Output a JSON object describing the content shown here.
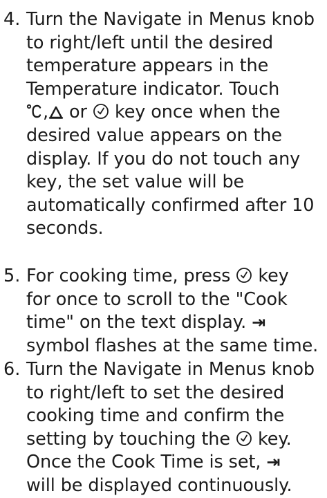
{
  "steps": [
    {
      "number": "4.",
      "lines": [
        "Turn the Navigate in Menus knob",
        "to right/left until the desired",
        "temperature appears in the",
        "Temperature indicator. Touch",
        ",",
        "or",
        "key once when the",
        "desired value appears on the",
        "display. If you do not touch any",
        "key, the set value will be",
        "automatically confirmed after 10",
        "seconds."
      ]
    },
    {
      "number": "5.",
      "lines": [
        "For cooking time, press",
        "key",
        "for once to scroll to the \"Cook",
        "time\" on the text display.",
        "symbol flashes at the same time."
      ]
    },
    {
      "number": "6.",
      "lines": [
        "Turn the Navigate in Menus knob",
        "to right/left to set the desired",
        "cooking time and confirm the",
        "setting by touching the",
        "key.",
        "Once the Cook Time is set,",
        "will be displayed continuously."
      ]
    }
  ],
  "symbols": {
    "arrow_bar": "⇥"
  },
  "icons": [
    "temperature-celsius-icon",
    "bell-icon",
    "clock-icon",
    "cook-time-arrow-icon"
  ]
}
